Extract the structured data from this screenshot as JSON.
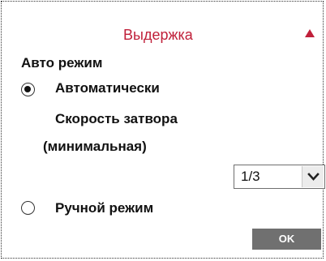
{
  "panel": {
    "title": "Выдержка",
    "title_color": "#c0203a",
    "collapse_icon": "triangle-up-icon",
    "mode_section_label": "Авто режим",
    "options": {
      "auto": {
        "label": "Автоматически",
        "selected": true
      },
      "min_shutter": {
        "label_line1": "Скорость затвора",
        "label_line2": "(минимальная)",
        "value": "1/3",
        "dropdown_icon": "chevron-down-icon"
      },
      "manual": {
        "label": "Ручной режим",
        "selected": false
      }
    },
    "ok_label": "OK",
    "ok_color": "#707070"
  }
}
